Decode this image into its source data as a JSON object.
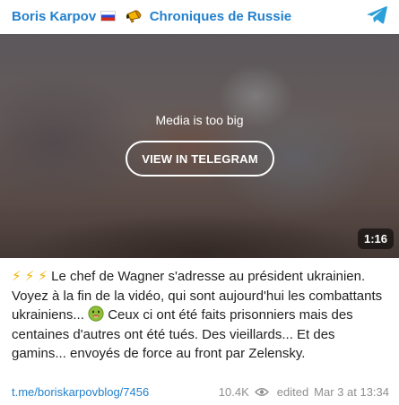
{
  "header": {
    "channel_name": "Boris Karpov",
    "channel_suffix": "Chroniques de Russie",
    "flag_icon": "russia-flag",
    "megaphone_icon": "megaphone",
    "logo_icon": "telegram-logo",
    "accent": "#2481cc"
  },
  "media": {
    "note": "Media is too big",
    "button_label": "VIEW IN TELEGRAM",
    "duration": "1:16"
  },
  "message": {
    "lightning": "⚡ ⚡ ⚡",
    "text_part1": " Le chef de Wagner s'adresse au président ukrainien. Voyez à la fin de la vidéo, qui sont aujourd'hui les combattants ukrainiens... ",
    "sick_emoji": "nauseated-face",
    "text_part2": " Ceux ci ont été faits prisonniers mais des centaines d'autres ont été tués. Des vieillards... Et des gamins... envoyés de force au front par Zelensky."
  },
  "footer": {
    "link": "t.me/boriskarpovblog/7456",
    "views": "10.4K",
    "views_icon": "eye",
    "edited": "edited",
    "date": "Mar 3 at 13:34",
    "meta_color": "#8f8f8f"
  }
}
